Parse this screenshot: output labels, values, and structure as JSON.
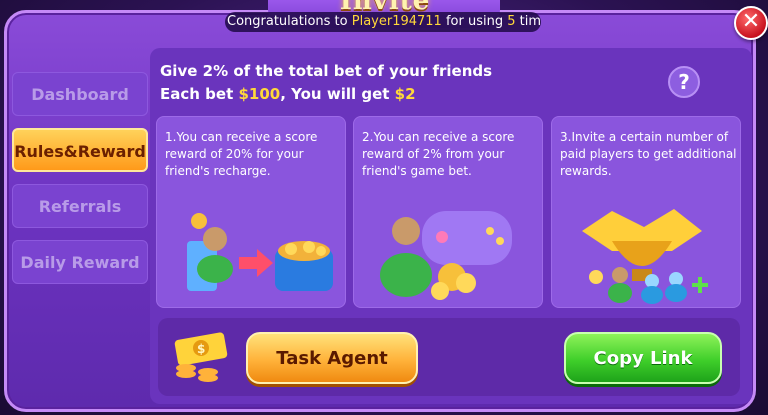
{
  "header": {
    "title": "Invite",
    "ticker_prefix": "Congratulations to ",
    "ticker_player": "Player194711",
    "ticker_middle": " for using ",
    "ticker_count": "5",
    "ticker_suffix": " times"
  },
  "close_label": "✕",
  "sidebar": {
    "items": [
      {
        "label": "Dashboard",
        "active": false
      },
      {
        "label": "Rules&Reward",
        "active": true
      },
      {
        "label": "Referrals",
        "active": false
      },
      {
        "label": "Daily Reward",
        "active": false
      }
    ]
  },
  "intro": {
    "line1": "Give 2% of the total bet of your friends",
    "line2_prefix": "Each bet ",
    "bet_amount": "$100",
    "line2_middle": ", You will get ",
    "reward_amount": "$2"
  },
  "help_label": "?",
  "cards": [
    {
      "text": "1.You can receive a score reward of 20% for your friend's recharge."
    },
    {
      "text": "2.You can receive a score reward of 2% from your friend's game bet."
    },
    {
      "text": "3.Invite a certain number of paid players to get additional rewards."
    }
  ],
  "actions": {
    "task_agent_label": "Task Agent",
    "copy_link_label": "Copy Link"
  },
  "colors": {
    "accent_gold": "#ffd83a",
    "active_tab": "#ffb23a",
    "copy_green": "#3fcf2a"
  }
}
